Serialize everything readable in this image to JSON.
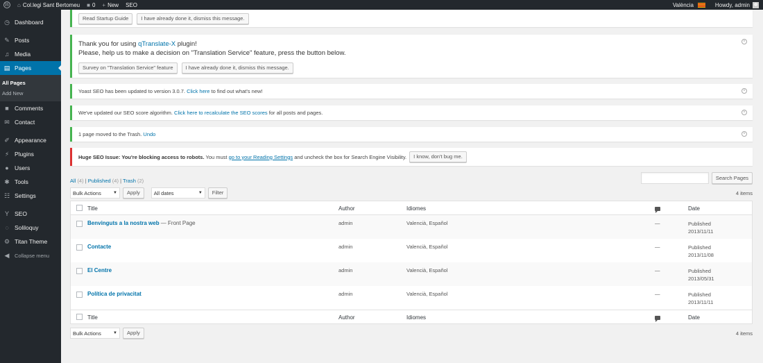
{
  "adminbar": {
    "site_name": "Col.legi Sant Bertomeu",
    "comments_count": "0",
    "new_label": "New",
    "seo_label": "SEO",
    "language": "València",
    "howdy": "Howdy, admin"
  },
  "sidebar": {
    "dashboard": "Dashboard",
    "posts": "Posts",
    "media": "Media",
    "pages": "Pages",
    "all_pages": "All Pages",
    "add_new": "Add New",
    "comments": "Comments",
    "contact": "Contact",
    "appearance": "Appearance",
    "plugins": "Plugins",
    "users": "Users",
    "tools": "Tools",
    "settings": "Settings",
    "seo": "SEO",
    "soliloquy": "Soliloquy",
    "titan": "Titan Theme",
    "collapse": "Collapse menu"
  },
  "notices": {
    "startup": {
      "read_guide": "Read Startup Guide",
      "dismiss": "I have already done it, dismiss this message."
    },
    "qtranslate": {
      "line1_pre": "Thank you for using ",
      "line1_link": "qTranslate-X",
      "line1_post": " plugin!",
      "line2": "Please, help us to make a decision on \"Translation Service\" feature, press the button below.",
      "survey": "Survey on \"Translation Service\" feature",
      "dismiss": "I have already done it, dismiss this message."
    },
    "yoast_update": {
      "pre": "Yoast SEO has been updated to version 3.0.7. ",
      "link": "Click here",
      "post": " to find out what's new!"
    },
    "seo_score": {
      "pre": "We've updated our SEO score algorithm. ",
      "link": "Click here to recalculate the SEO scores",
      "post": " for all posts and pages."
    },
    "trash": {
      "pre": "1 page moved to the Trash. ",
      "link": "Undo"
    },
    "robots": {
      "bold": "Huge SEO Issue: You're blocking access to robots.",
      "pre": " You must ",
      "link": "go to your Reading Settings",
      "post": " and uncheck the box for Search Engine Visibility.",
      "button": "I know, don't bug me."
    }
  },
  "filters": {
    "all": "All",
    "all_count": "(4)",
    "published": "Published",
    "published_count": "(4)",
    "trash": "Trash",
    "trash_count": "(2)",
    "sep": "|"
  },
  "search_button": "Search Pages",
  "tablenav_top": {
    "bulk_actions": "Bulk Actions",
    "apply": "Apply",
    "dates": "All dates",
    "filter": "Filter",
    "items": "4 items"
  },
  "tablenav_bottom": {
    "bulk_actions": "Bulk Actions",
    "apply": "Apply",
    "items": "4 items"
  },
  "columns": {
    "title": "Title",
    "author": "Author",
    "languages": "Idiomes",
    "date": "Date"
  },
  "rows": [
    {
      "title": "Benvinguts a la nostra web",
      "state": " — Front Page",
      "author": "admin",
      "languages": "Valencià, Español",
      "comments": "—",
      "status": "Published",
      "date": "2013/11/11"
    },
    {
      "title": "Contacte",
      "state": "",
      "author": "admin",
      "languages": "Valencià, Español",
      "comments": "—",
      "status": "Published",
      "date": "2013/11/08"
    },
    {
      "title": "El Centre",
      "state": "",
      "author": "admin",
      "languages": "Valencià, Español",
      "comments": "—",
      "status": "Published",
      "date": "2013/05/31"
    },
    {
      "title": "Política de privacitat",
      "state": "",
      "author": "admin",
      "languages": "Valencià, Español",
      "comments": "—",
      "status": "Published",
      "date": "2013/11/11"
    }
  ]
}
